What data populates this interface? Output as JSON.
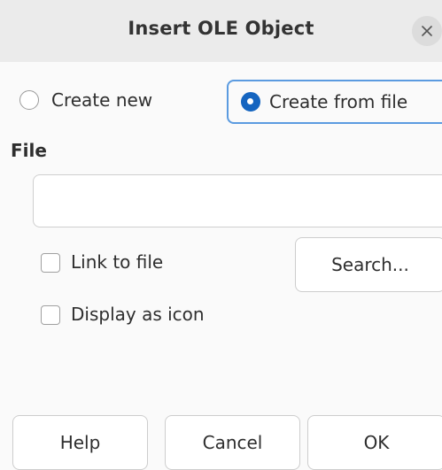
{
  "dialog": {
    "title": "Insert OLE Object"
  },
  "mode": {
    "create_new_label": "Create new",
    "create_from_file_label": "Create from file",
    "selected": "create_from_file"
  },
  "file": {
    "section_label": "File",
    "path_value": "",
    "search_label": "Search..."
  },
  "options": {
    "link_to_file_label": "Link to file",
    "link_to_file_checked": false,
    "display_as_icon_label": "Display as icon",
    "display_as_icon_checked": false
  },
  "footer": {
    "help_label": "Help",
    "cancel_label": "Cancel",
    "ok_label": "OK"
  },
  "colors": {
    "accent": "#1565c0",
    "focus_ring": "#5b9be0",
    "titlebar": "#ebebeb",
    "background": "#fafafa"
  }
}
